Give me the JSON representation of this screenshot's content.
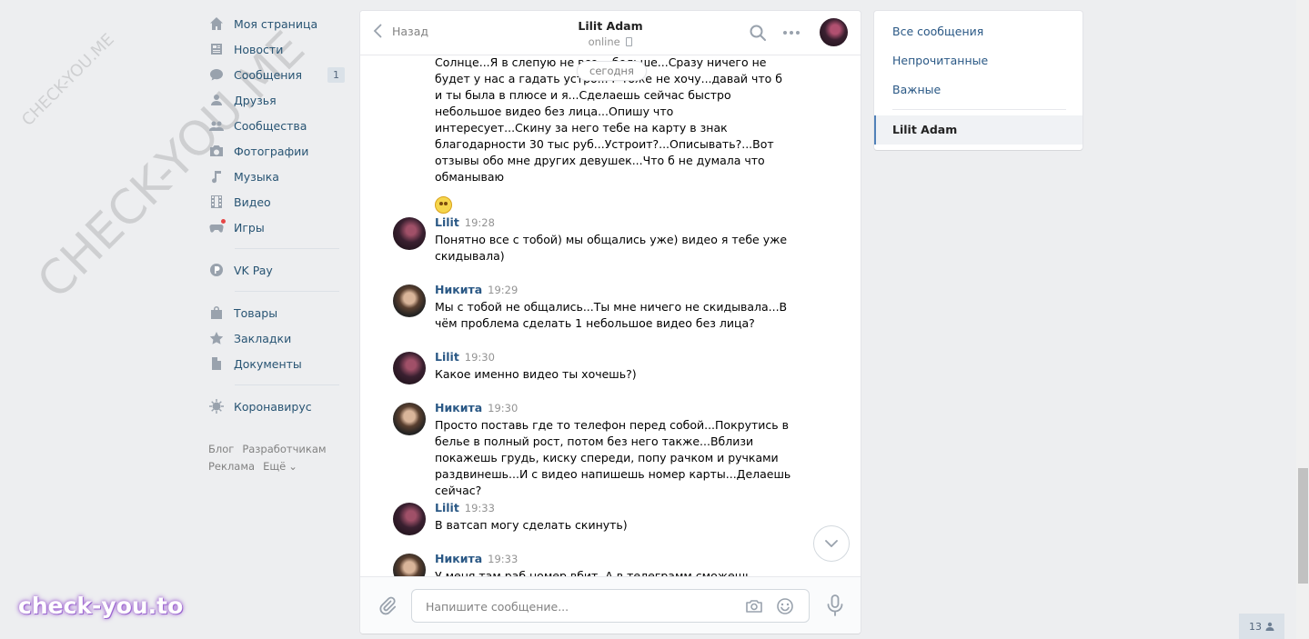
{
  "left_nav": {
    "items": [
      {
        "label": "Моя страница",
        "icon": "home-icon"
      },
      {
        "label": "Новости",
        "icon": "news-icon"
      },
      {
        "label": "Сообщения",
        "icon": "messages-icon",
        "count": "1"
      },
      {
        "label": "Друзья",
        "icon": "friends-icon"
      },
      {
        "label": "Сообщества",
        "icon": "groups-icon"
      },
      {
        "label": "Фотографии",
        "icon": "photos-icon"
      },
      {
        "label": "Музыка",
        "icon": "music-icon"
      },
      {
        "label": "Видео",
        "icon": "video-icon"
      },
      {
        "label": "Игры",
        "icon": "games-icon"
      }
    ],
    "vkpay": {
      "label": "VK Pay",
      "icon": "vkpay-icon"
    },
    "items2": [
      {
        "label": "Товары",
        "icon": "goods-icon"
      },
      {
        "label": "Закладки",
        "icon": "bookmarks-icon"
      },
      {
        "label": "Документы",
        "icon": "documents-icon"
      }
    ],
    "corona": {
      "label": "Коронавирус",
      "icon": "virus-icon"
    },
    "footer": {
      "blog": "Блог",
      "developers": "Разработчикам",
      "ads": "Реклама",
      "more": "Ещё"
    }
  },
  "chat": {
    "back_label": "Назад",
    "peer_name": "Lilit Adam",
    "peer_status": "online",
    "date_pill": "сегодня",
    "first_message": "Солнце...Я в слепую не все... больше...Сразу ничего не будет у нас а гадать устро... г тоже не хочу...давай что б и ты была в плюсе и я...Сделаешь сейчас быстро небольшое видео без лица...Опишу что интересует...Скину за него тебе на карту в знак благодарности 30 тыс руб...Устроит?...Описывать?...Вот отзывы обо мне других девушек...Что б не думала что обманываю",
    "messages": [
      {
        "author": "Lilit",
        "time": "19:28",
        "text": "Понятно все с тобой) мы общались уже) видео я тебе уже скидывала)"
      },
      {
        "author": "Никита",
        "time": "19:29",
        "text": "Мы с тобой не общались...Ты мне ничего не скидывала...В чём проблема сделать 1 небольшое видео без лица?"
      },
      {
        "author": "Lilit",
        "time": "19:30",
        "text": "Какое именно видео ты хочешь?)"
      },
      {
        "author": "Никита",
        "time": "19:30",
        "text": "Просто поставь где то телефон перед собой...Покрутись в белье в полный рост, потом без него также...Вблизи покажешь грудь, киску спереди, попу рачком и ручками раздвинешь...И с видео напишешь номер карты...Делаешь сейчас?"
      },
      {
        "author": "Lilit",
        "time": "19:33",
        "text": "В ватсап могу сделать скинуть)"
      },
      {
        "author": "Никита",
        "time": "19:33",
        "text": "У меня там раб номер вбит. А в телеграмм сможешь скинуть?"
      }
    ],
    "composer_placeholder": "Напишите сообщение..."
  },
  "right_nav": {
    "items": [
      "Все сообщения",
      "Непрочитанные",
      "Важные"
    ],
    "active": "Lilit Adam"
  },
  "online_counter": "13",
  "watermarks": {
    "small": "CHECK-YOU.ME",
    "large": "CHECK-YOU.ME",
    "bottom": "check-you.to"
  },
  "colors": {
    "link": "#2a5885",
    "accent": "#5181b8",
    "background": "#edeef0"
  }
}
